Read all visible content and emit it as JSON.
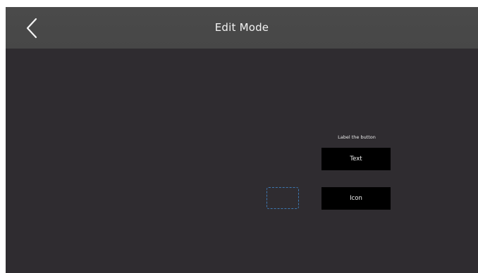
{
  "header": {
    "title": "Edit Mode",
    "back_icon": "chevron-left-icon"
  },
  "editor": {
    "caption": "Label the button",
    "options": {
      "text_label": "Text",
      "icon_label": "Icon"
    },
    "placeholder_color": "#3d78b2"
  },
  "colors": {
    "background": "#2f2c30",
    "header": "#4a4a4a",
    "button": "#000000",
    "text": "#f2f2f2"
  }
}
